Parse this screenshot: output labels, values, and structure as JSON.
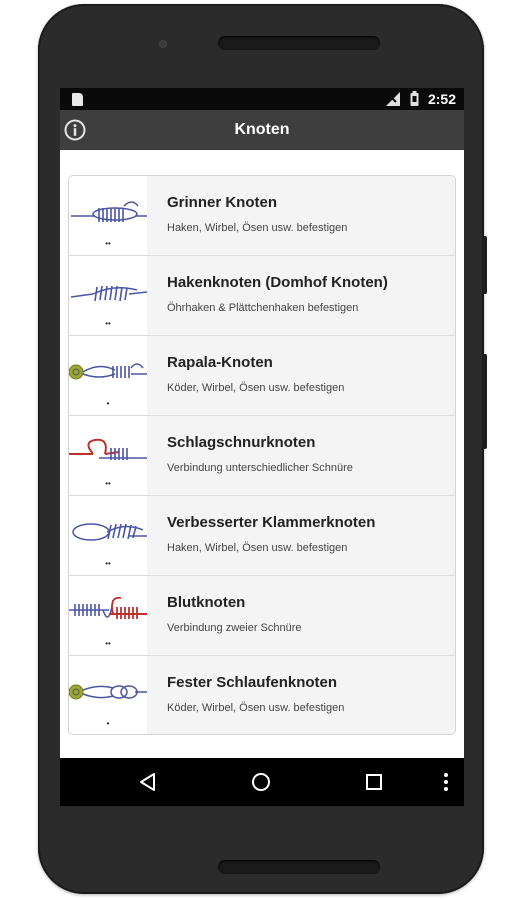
{
  "status_bar": {
    "time": "2:52",
    "icons": [
      "sd-card-icon",
      "signal-icon",
      "battery-icon"
    ]
  },
  "app_bar": {
    "title": "Knoten",
    "info_icon": "info-icon"
  },
  "knots": [
    {
      "title": "Grinner Knoten",
      "subtitle": "Haken, Wirbel, Ösen usw. befestigen",
      "rating": "••",
      "accent": "#4a55a6"
    },
    {
      "title": "Hakenknoten (Domhof Knoten)",
      "subtitle": "Öhrhaken & Plättchenhaken befestigen",
      "rating": "••",
      "accent": "#4a55a6"
    },
    {
      "title": "Rapala-Knoten",
      "subtitle": "Köder, Wirbel, Ösen usw. befestigen",
      "rating": "•",
      "accent": "#4a55a6"
    },
    {
      "title": "Schlagschnurknoten",
      "subtitle": "Verbindung unterschiedlicher Schnüre",
      "rating": "••",
      "accent": "#c0302a"
    },
    {
      "title": "Verbesserter Klammerknoten",
      "subtitle": "Haken, Wirbel, Ösen usw. befestigen",
      "rating": "••",
      "accent": "#4a55a6"
    },
    {
      "title": "Blutknoten",
      "subtitle": "Verbindung zweier Schnüre",
      "rating": "••",
      "accent": "#c0302a"
    },
    {
      "title": "Fester Schlaufenknoten",
      "subtitle": "Köder, Wirbel, Ösen usw. befestigen",
      "rating": "•",
      "accent": "#4a55a6"
    }
  ],
  "nav_bar": {
    "buttons": [
      "back-icon",
      "home-icon",
      "recents-icon",
      "overflow-menu-icon"
    ]
  },
  "colors": {
    "app_bar": "#3e3e3e",
    "status_bar": "#0a0a0a",
    "list_text_bg": "#f4f4f4",
    "knot_blue": "#4a55a6",
    "knot_red": "#c0302a",
    "lure_green": "#9aa832"
  }
}
